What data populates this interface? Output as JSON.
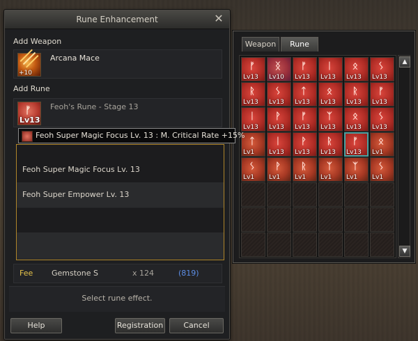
{
  "window": {
    "title": "Rune Enhancement",
    "close_symbol": "✕",
    "add_weapon_label": "Add Weapon",
    "weapon": {
      "name": "Arcana Mace",
      "icon": "mace-icon",
      "caption": "+10"
    },
    "add_rune_label": "Add Rune",
    "rune": {
      "name": "Feoh's Rune - Stage 13",
      "icon": "feoh-rune-icon",
      "level_text": "Lv13",
      "glyph": "ᚠ"
    },
    "tooltip": "Feoh Super Magic Focus Lv. 13 : M. Critical Rate +15%",
    "effects": [
      "Feoh Super Magic Focus Lv. 13",
      "Feoh Super Empower Lv. 13"
    ],
    "fee": {
      "label": "Fee",
      "item": "Gemstone S",
      "qty": "x 124",
      "owned": "(819)"
    },
    "status": "Select rune effect.",
    "buttons": {
      "help": "Help",
      "registration": "Registration",
      "cancel": "Cancel"
    }
  },
  "inventory": {
    "tabs": [
      "Weapon",
      "Rune"
    ],
    "active_tab": "Rune",
    "scroll_up_symbol": "▲",
    "scroll_down_symbol": "▼",
    "cells": [
      {
        "glyph": "ᚠ",
        "lv": "Lv13",
        "kind": "rune"
      },
      {
        "glyph": "ᛝ",
        "lv": "Lv10",
        "kind": "purple"
      },
      {
        "glyph": "ᚠ",
        "lv": "Lv13",
        "kind": "rune"
      },
      {
        "glyph": "ᛁ",
        "lv": "Lv13",
        "kind": "rune"
      },
      {
        "glyph": "ᛟ",
        "lv": "Lv13",
        "kind": "rune"
      },
      {
        "glyph": "ᛊ",
        "lv": "Lv13",
        "kind": "rune"
      },
      {
        "glyph": "ᚱ",
        "lv": "Lv13",
        "kind": "rune"
      },
      {
        "glyph": "ᛊ",
        "lv": "Lv13",
        "kind": "rune"
      },
      {
        "glyph": "ᛏ",
        "lv": "Lv13",
        "kind": "rune"
      },
      {
        "glyph": "ᛟ",
        "lv": "Lv13",
        "kind": "rune"
      },
      {
        "glyph": "ᚱ",
        "lv": "Lv13",
        "kind": "rune"
      },
      {
        "glyph": "ᚠ",
        "lv": "Lv13",
        "kind": "rune"
      },
      {
        "glyph": "ᛁ",
        "lv": "Lv13",
        "kind": "rune"
      },
      {
        "glyph": "ᚹ",
        "lv": "Lv13",
        "kind": "rune"
      },
      {
        "glyph": "ᚠ",
        "lv": "Lv13",
        "kind": "rune"
      },
      {
        "glyph": "ᛉ",
        "lv": "Lv13",
        "kind": "rune"
      },
      {
        "glyph": "ᛟ",
        "lv": "Lv13",
        "kind": "rune"
      },
      {
        "glyph": "ᛊ",
        "lv": "Lv13",
        "kind": "rune"
      },
      {
        "glyph": "ᛏ",
        "lv": "Lv1",
        "kind": "lv1"
      },
      {
        "glyph": "ᛁ",
        "lv": "Lv13",
        "kind": "rune"
      },
      {
        "glyph": "ᚹ",
        "lv": "Lv13",
        "kind": "rune"
      },
      {
        "glyph": "ᚱ",
        "lv": "Lv13",
        "kind": "rune"
      },
      {
        "glyph": "ᚠ",
        "lv": "Lv13",
        "kind": "rune",
        "selected": true
      },
      {
        "glyph": "ᛟ",
        "lv": "Lv1",
        "kind": "lv1"
      },
      {
        "glyph": "ᛊ",
        "lv": "Lv1",
        "kind": "lv1"
      },
      {
        "glyph": "ᚹ",
        "lv": "Lv1",
        "kind": "lv1"
      },
      {
        "glyph": "ᚱ",
        "lv": "Lv1",
        "kind": "lv1"
      },
      {
        "glyph": "ᛉ",
        "lv": "Lv1",
        "kind": "lv1"
      },
      {
        "glyph": "ᛉ",
        "lv": "Lv1",
        "kind": "lv1"
      },
      {
        "glyph": "ᛊ",
        "lv": "Lv1",
        "kind": "lv1"
      }
    ]
  }
}
